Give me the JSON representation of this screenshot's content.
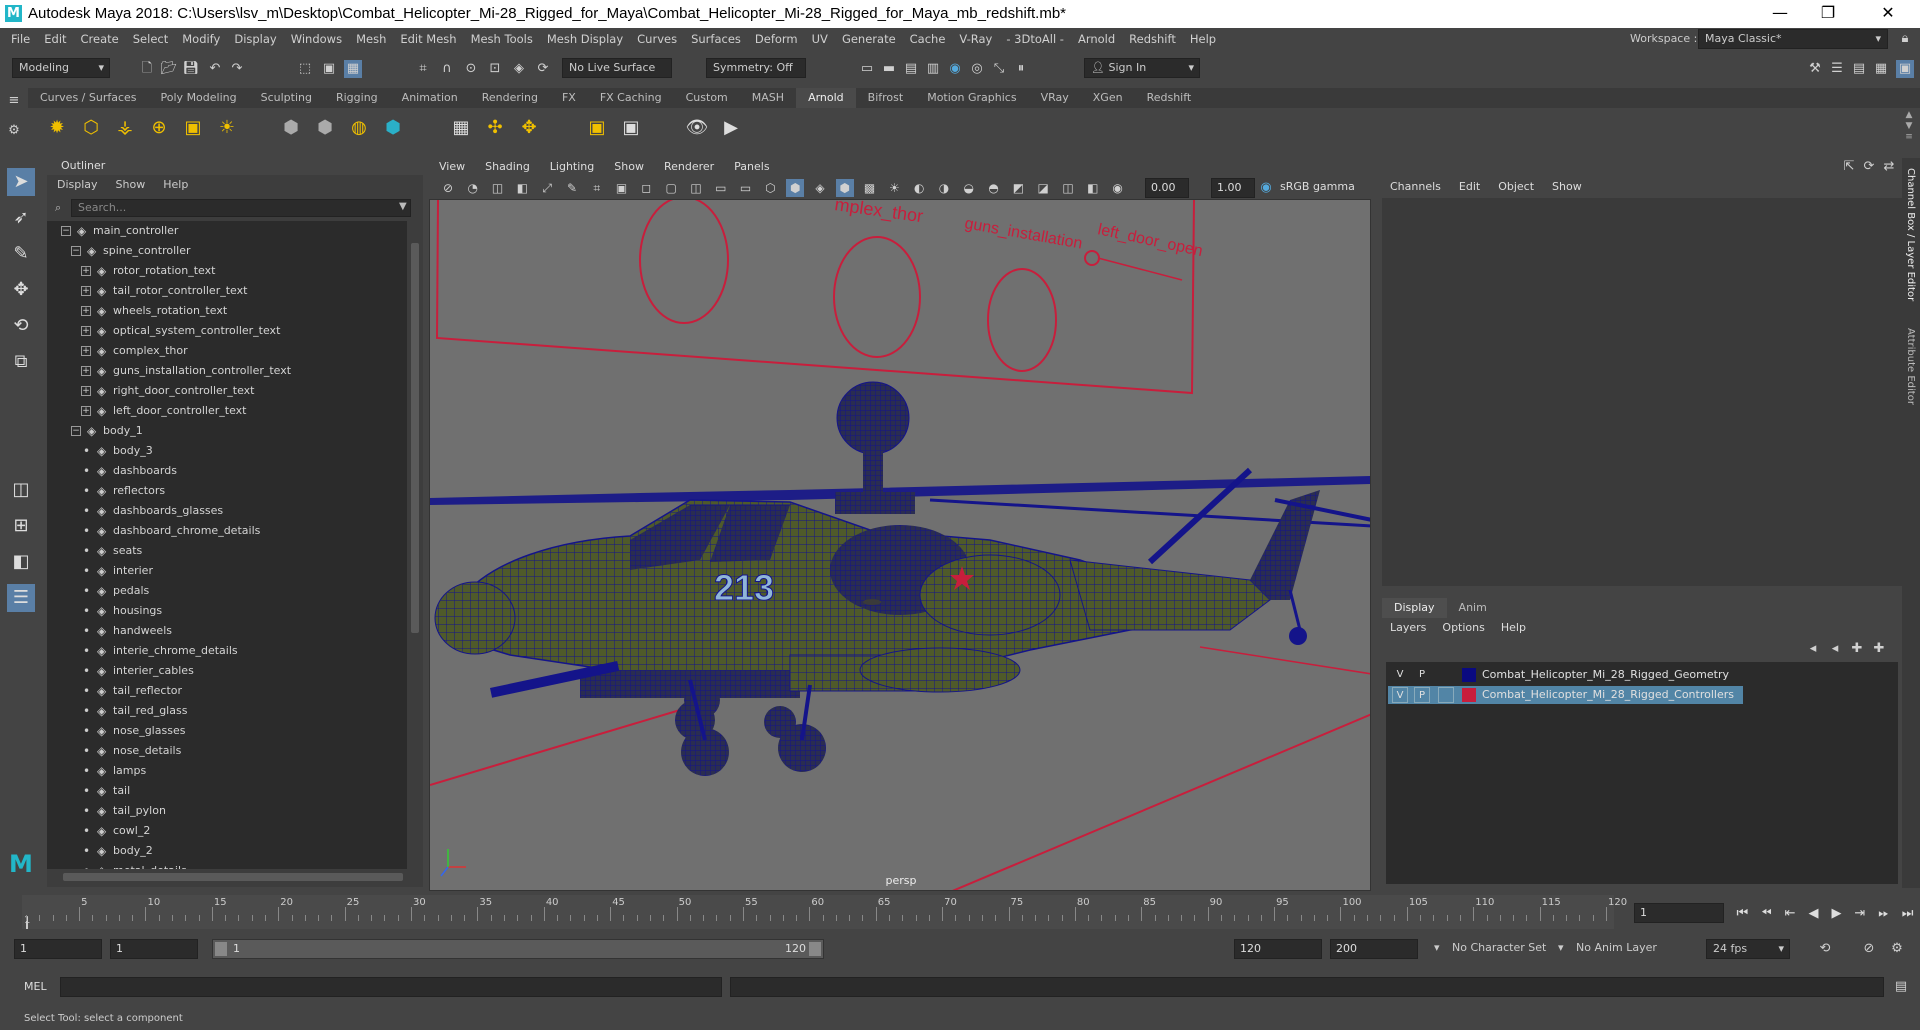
{
  "window": {
    "title": "Autodesk Maya 2018: C:\\Users\\lsv_m\\Desktop\\Combat_Helicopter_Mi-28_Rigged_for_Maya\\Combat_Helicopter_Mi-28_Rigged_for_Maya_mb_redshift.mb*",
    "logo": "M"
  },
  "menu": [
    "File",
    "Edit",
    "Create",
    "Select",
    "Modify",
    "Display",
    "Windows",
    "Mesh",
    "Edit Mesh",
    "Mesh Tools",
    "Mesh Display",
    "Curves",
    "Surfaces",
    "Deform",
    "UV",
    "Generate",
    "Cache",
    "V-Ray",
    "- 3DtoAll -",
    "Arnold",
    "Redshift",
    "Help"
  ],
  "workspace": {
    "label": "Workspace :",
    "value": "Maya Classic*"
  },
  "statusline": {
    "mode": "Modeling",
    "live_surface": "No Live Surface",
    "symmetry": "Symmetry: Off",
    "sign_in": "Sign In"
  },
  "shelf_tabs": [
    "Curves / Surfaces",
    "Poly Modeling",
    "Sculpting",
    "Rigging",
    "Animation",
    "Rendering",
    "FX",
    "FX Caching",
    "Custom",
    "MASH",
    "Arnold",
    "Bifrost",
    "Motion Graphics",
    "VRay",
    "XGen",
    "Redshift"
  ],
  "active_shelf": "Arnold",
  "outliner": {
    "title": "Outliner",
    "menu": [
      "Display",
      "Show",
      "Help"
    ],
    "search_placeholder": "Search...",
    "items": [
      {
        "label": "main_controller",
        "depth": 0,
        "expand": "−"
      },
      {
        "label": "spine_controller",
        "depth": 1,
        "expand": "−"
      },
      {
        "label": "rotor_rotation_text",
        "depth": 2,
        "expand": "+"
      },
      {
        "label": "tail_rotor_controller_text",
        "depth": 2,
        "expand": "+"
      },
      {
        "label": "wheels_rotation_text",
        "depth": 2,
        "expand": "+"
      },
      {
        "label": "optical_system_controller_text",
        "depth": 2,
        "expand": "+"
      },
      {
        "label": "complex_thor",
        "depth": 2,
        "expand": "+"
      },
      {
        "label": "guns_installation_controller_text",
        "depth": 2,
        "expand": "+"
      },
      {
        "label": "right_door_controller_text",
        "depth": 2,
        "expand": "+"
      },
      {
        "label": "left_door_controller_text",
        "depth": 2,
        "expand": "+"
      },
      {
        "label": "body_1",
        "depth": 1,
        "expand": "−"
      },
      {
        "label": "body_3",
        "depth": 2,
        "expand": ""
      },
      {
        "label": "dashboards",
        "depth": 2,
        "expand": ""
      },
      {
        "label": "reflectors",
        "depth": 2,
        "expand": ""
      },
      {
        "label": "dashboards_glasses",
        "depth": 2,
        "expand": ""
      },
      {
        "label": "dashboard_chrome_details",
        "depth": 2,
        "expand": ""
      },
      {
        "label": "seats",
        "depth": 2,
        "expand": ""
      },
      {
        "label": "interier",
        "depth": 2,
        "expand": ""
      },
      {
        "label": "pedals",
        "depth": 2,
        "expand": ""
      },
      {
        "label": "housings",
        "depth": 2,
        "expand": ""
      },
      {
        "label": "handweels",
        "depth": 2,
        "expand": ""
      },
      {
        "label": "interie_chrome_details",
        "depth": 2,
        "expand": ""
      },
      {
        "label": "interier_cables",
        "depth": 2,
        "expand": ""
      },
      {
        "label": "tail_reflector",
        "depth": 2,
        "expand": ""
      },
      {
        "label": "tail_red_glass",
        "depth": 2,
        "expand": ""
      },
      {
        "label": "nose_glasses",
        "depth": 2,
        "expand": ""
      },
      {
        "label": "nose_details",
        "depth": 2,
        "expand": ""
      },
      {
        "label": "lamps",
        "depth": 2,
        "expand": ""
      },
      {
        "label": "tail",
        "depth": 2,
        "expand": ""
      },
      {
        "label": "tail_pylon",
        "depth": 2,
        "expand": ""
      },
      {
        "label": "cowl_2",
        "depth": 2,
        "expand": ""
      },
      {
        "label": "body_2",
        "depth": 2,
        "expand": ""
      },
      {
        "label": "metal_details",
        "depth": 2,
        "expand": ""
      }
    ]
  },
  "viewport": {
    "menu": [
      "View",
      "Shading",
      "Lighting",
      "Show",
      "Renderer",
      "Panels"
    ],
    "exposure": "0.00",
    "gamma": "1.00",
    "colorspace": "sRGB gamma",
    "camera": "persp",
    "scene_text": [
      "mplex_thor",
      "guns_installation",
      "left_door_open"
    ],
    "hull_number": "213",
    "colors": {
      "wire": "#14148a",
      "controller": "#c81e3c",
      "hull": "#4f5a2a"
    }
  },
  "channelbox": {
    "menu": [
      "Channels",
      "Edit",
      "Object",
      "Show"
    ]
  },
  "layers": {
    "tabs": [
      "Display",
      "Anim"
    ],
    "active_tab": "Display",
    "menu": [
      "Layers",
      "Options",
      "Help"
    ],
    "rows": [
      {
        "v": "V",
        "p": "P",
        "color": "#0a0a80",
        "name": "Combat_Helicopter_Mi_28_Rigged_Geometry",
        "selected": false
      },
      {
        "v": "V",
        "p": "P",
        "color": "#c81e3c",
        "name": "Combat_Helicopter_Mi_28_Rigged_Controllers",
        "selected": true
      }
    ]
  },
  "side_tabs": [
    "Channel Box / Layer Editor",
    "Attribute Editor"
  ],
  "timeline": {
    "ticks": [
      5,
      10,
      15,
      20,
      25,
      30,
      35,
      40,
      45,
      50,
      55,
      60,
      65,
      70,
      75,
      80,
      85,
      90,
      95,
      100,
      105,
      110,
      115,
      120
    ],
    "start_label": "1",
    "current_frame": "1"
  },
  "range": {
    "start": "1",
    "playback_start": "1",
    "slider_start": "1",
    "slider_end": "120",
    "playback_end": "120",
    "end": "200",
    "character_set": "No Character Set",
    "anim_layer": "No Anim Layer",
    "fps": "24 fps"
  },
  "mel": {
    "label": "MEL"
  },
  "helpline": "Select Tool: select a component"
}
